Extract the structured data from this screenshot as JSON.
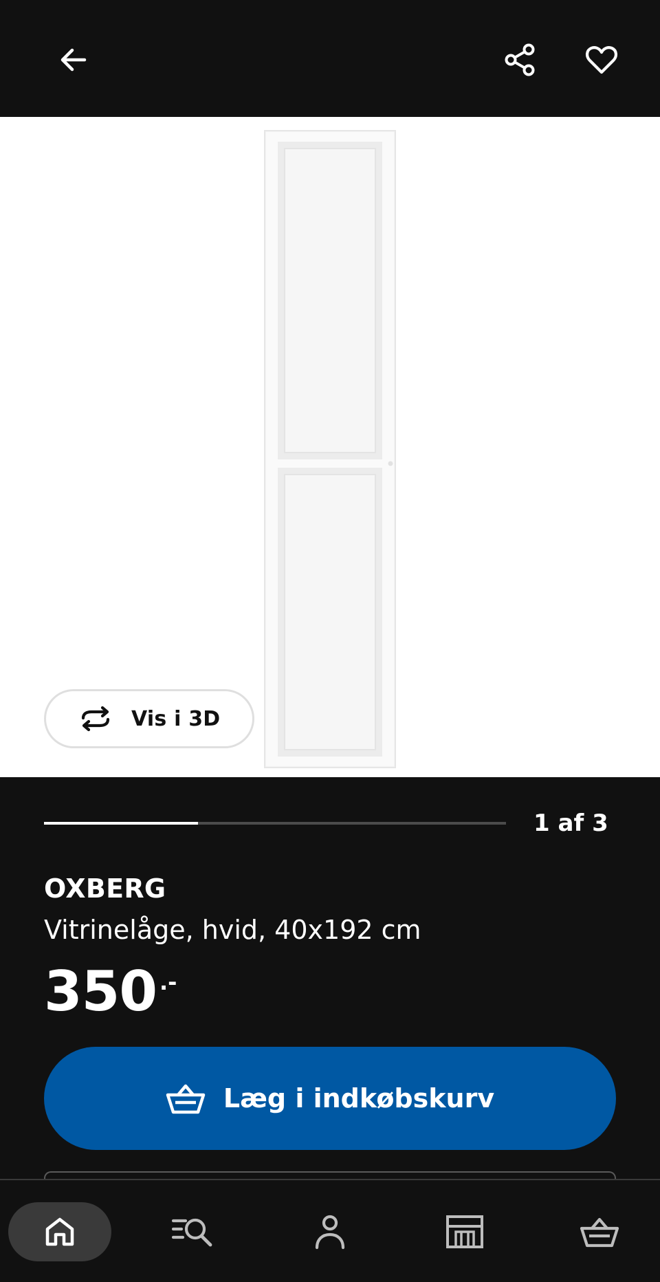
{
  "header": {
    "back_icon": "arrow-left-icon",
    "share_icon": "share-icon",
    "favorite_icon": "heart-icon"
  },
  "gallery": {
    "view_3d_label": "Vis i 3D",
    "view_3d_icon": "rotate-3d-icon",
    "current_image": 1,
    "total_images": 3,
    "counter_text": "1 af 3",
    "progress_fraction": 0.333
  },
  "product": {
    "name": "OXBERG",
    "description": "Vitrinelåge, hvid, 40x192 cm",
    "price_main": "350",
    "price_suffix": ".-"
  },
  "cart_button": {
    "label": "Læg i indkøbskurv",
    "icon": "shopping-basket-icon",
    "color": "#0058a3"
  },
  "bottom_nav": {
    "items": [
      {
        "icon": "home-icon",
        "active": true
      },
      {
        "icon": "search-list-icon",
        "active": false
      },
      {
        "icon": "person-icon",
        "active": false
      },
      {
        "icon": "store-icon",
        "active": false
      },
      {
        "icon": "basket-icon",
        "active": false
      }
    ]
  },
  "colors": {
    "background": "#111111",
    "primary_blue": "#0058a3",
    "text": "#ffffff"
  }
}
